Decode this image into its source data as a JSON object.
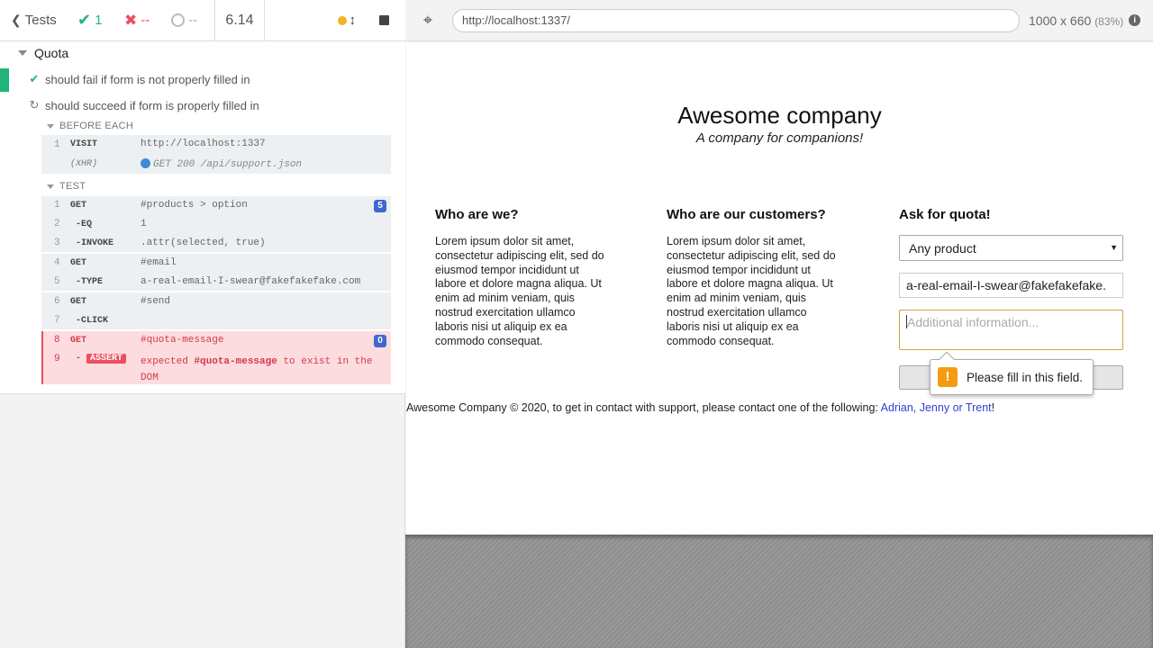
{
  "reporter": {
    "back_label": "Tests",
    "passed": "1",
    "failed": "--",
    "pending": "--",
    "duration": "6.14",
    "suite_title": "Quota",
    "tests": [
      {
        "title": "should fail if form is not properly filled in",
        "state": "passed"
      },
      {
        "title": "should succeed if form is properly filled in",
        "state": "running"
      }
    ],
    "before_each": {
      "title": "BEFORE EACH",
      "commands": [
        {
          "num": "1",
          "name": "VISIT",
          "message": "http://localhost:1337"
        },
        {
          "num": "",
          "name": "(XHR)",
          "message": "GET 200 /api/support.json"
        }
      ]
    },
    "test_section": {
      "title": "TEST",
      "commands": [
        {
          "num": "1",
          "name": "GET",
          "message": "#products > option",
          "badge": "5"
        },
        {
          "num": "2",
          "name": "-EQ",
          "message": "1"
        },
        {
          "num": "3",
          "name": "-INVOKE",
          "message": ".attr(selected, true)"
        },
        {
          "num": "4",
          "name": "GET",
          "message": "#email"
        },
        {
          "num": "5",
          "name": "-TYPE",
          "message": "a-real-email-I-swear@fakefakefake.com"
        },
        {
          "num": "6",
          "name": "GET",
          "message": "#send"
        },
        {
          "num": "7",
          "name": "-CLICK",
          "message": ""
        },
        {
          "num": "8",
          "name": "GET",
          "message": "#quota-message",
          "badge": "0"
        },
        {
          "num": "9",
          "name": "ASSERT",
          "message_pre": "expected",
          "message_em": "#quota-message",
          "message_post": "to exist in the",
          "message_line2": "DOM"
        }
      ]
    }
  },
  "aut": {
    "url": "http://localhost:1337/",
    "viewport": "1000 x 660",
    "scale": "(83%)",
    "info_icon": "i"
  },
  "site": {
    "title": "Awesome company",
    "subtitle": "A company for companions!",
    "col1": {
      "heading": "Who are we?",
      "text": "Lorem ipsum dolor sit amet, consectetur adipiscing elit, sed do eiusmod tempor incididunt ut labore et dolore magna aliqua. Ut enim ad minim veniam, quis nostrud exercitation ullamco laboris nisi ut aliquip ex ea commodo consequat."
    },
    "col2": {
      "heading": "Who are our customers?",
      "text": "Lorem ipsum dolor sit amet, consectetur adipiscing elit, sed do eiusmod tempor incididunt ut labore et dolore magna aliqua. Ut enim ad minim veniam, quis nostrud exercitation ullamco laboris nisi ut aliquip ex ea commodo consequat."
    },
    "form": {
      "heading": "Ask for quota!",
      "product_selected": "Any product",
      "email_value": "a-real-email-I-swear@fakefakefake.",
      "info_placeholder": "Additional information...",
      "validation_message": "Please fill in this field."
    },
    "footer": {
      "text": "Awesome Company © 2020, to get in contact with support, please contact one of the following: ",
      "links": "Adrian, Jenny or Trent",
      "suffix": "!"
    }
  }
}
